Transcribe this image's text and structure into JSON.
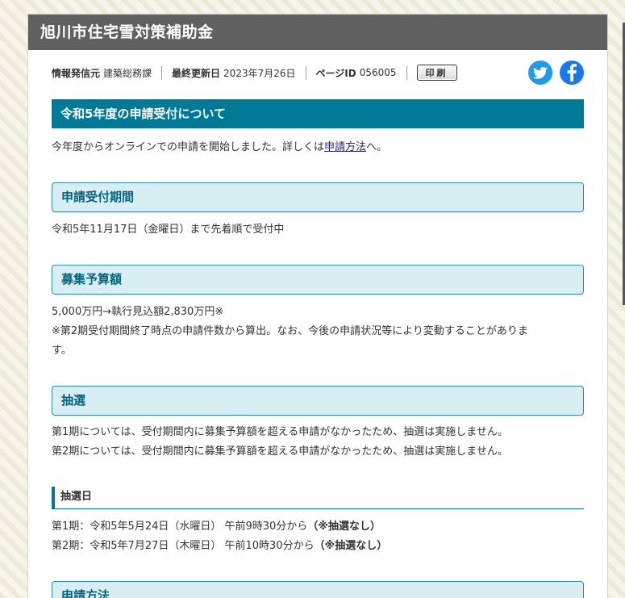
{
  "header": {
    "title": "旭川市住宅雪対策補助金"
  },
  "meta": {
    "source_label": "情報発信元",
    "source_value": "建築総務課",
    "updated_label": "最終更新日",
    "updated_value": "2023年7月26日",
    "pageid_label": "ページID",
    "pageid_value": "056005",
    "print_label": "印刷"
  },
  "social": {
    "twitter_icon": "twitter-icon",
    "facebook_icon": "facebook-icon",
    "twitter_color": "#1d9bf0",
    "facebook_color": "#1877f2"
  },
  "section_main": {
    "heading": "令和5年度の申請受付について",
    "text_before": "今年度からオンラインでの申請を開始しました。詳しくは",
    "link": "申請方法",
    "text_after": "へ。"
  },
  "period": {
    "heading": "申請受付期間",
    "text": "令和5年11月17日（金曜日）まで先着順で受付中"
  },
  "budget": {
    "heading": "募集予算額",
    "line1": "5,000万円→執行見込額2,830万円※",
    "line2": "※第2期受付期間終了時点の申請件数から算出。なお、今後の申請状況等により変動することがありま",
    "line3": "す。"
  },
  "lottery": {
    "heading": "抽選",
    "line1": "第1期については、受付期間内に募集予算額を超える申請がなかったため、抽選は実施しません。",
    "line2": "第2期については、受付期間内に募集予算額を超える申請がなかったため、抽選は実施しません。"
  },
  "lottery_date": {
    "heading": "抽選日",
    "line1": "第1期：令和5年5月24日（水曜日） 午前9時30分から",
    "line1_note": "（※抽選なし）",
    "line2": "第2期：令和5年7月27日（木曜日） 午前10時30分から",
    "line2_note": "（※抽選なし）"
  },
  "method": {
    "heading": "申請方法"
  },
  "colors": {
    "title_bar": "#606060",
    "accent": "#007a96",
    "subhead_bg": "#d8eef3"
  }
}
